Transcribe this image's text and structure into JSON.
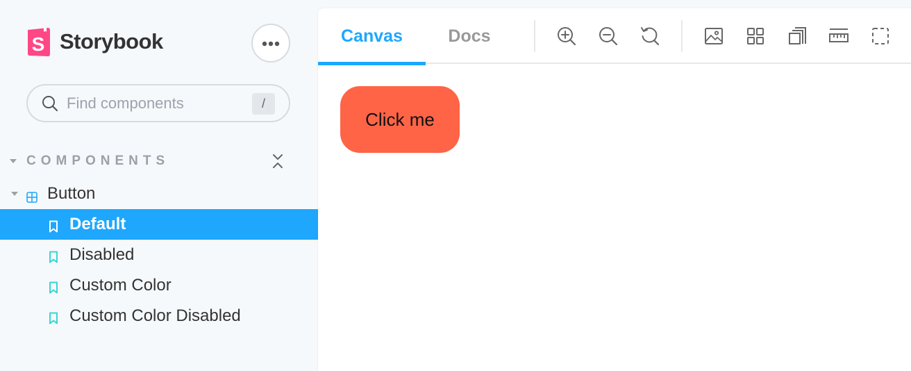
{
  "sidebar": {
    "brand_name": "Storybook",
    "search_placeholder": "Find components",
    "search_shortcut": "/",
    "section_title": "COMPONENTS",
    "group": {
      "label": "Button"
    },
    "stories": [
      {
        "label": "Default",
        "selected": true
      },
      {
        "label": "Disabled",
        "selected": false
      },
      {
        "label": "Custom Color",
        "selected": false
      },
      {
        "label": "Custom Color Disabled",
        "selected": false
      }
    ]
  },
  "toolbar": {
    "tabs": [
      {
        "label": "Canvas",
        "active": true
      },
      {
        "label": "Docs",
        "active": false
      }
    ],
    "tools": [
      "zoom-in-icon",
      "zoom-out-icon",
      "reset-zoom-icon",
      "background-icon",
      "grid-icon",
      "viewport-icon",
      "measure-icon",
      "outline-icon"
    ]
  },
  "preview": {
    "button_label": "Click me"
  },
  "colors": {
    "accent": "#1ea7fd",
    "brand_pink": "#ff4785",
    "story_icon": "#37d5d3",
    "demo_button": "#ff6446"
  }
}
